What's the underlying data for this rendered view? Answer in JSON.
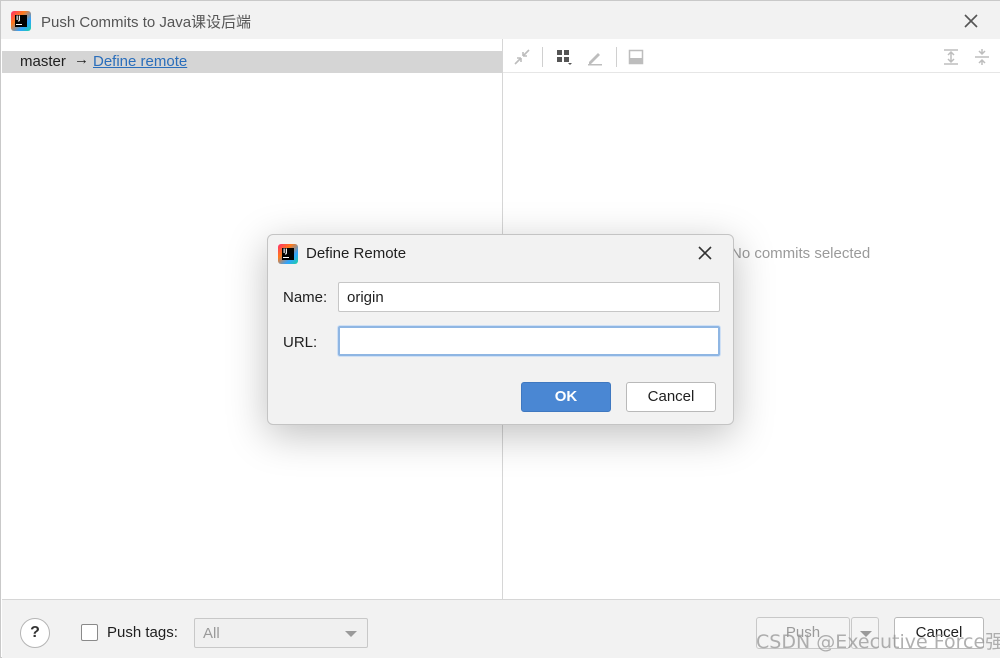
{
  "window": {
    "title": "Push Commits to Java课设后端"
  },
  "left": {
    "branch": "master",
    "arrow": "→",
    "define_remote_link": "Define remote"
  },
  "right": {
    "empty_text": "No commits selected"
  },
  "bottom": {
    "help_label": "?",
    "push_tags_label": "Push tags:",
    "push_tags_checked": false,
    "tags_select_value": "All",
    "push_label": "Push",
    "cancel_label": "Cancel"
  },
  "modal": {
    "title": "Define Remote",
    "name_label": "Name:",
    "name_value": "origin",
    "url_label": "URL:",
    "url_value": "",
    "ok_label": "OK",
    "cancel_label": "Cancel"
  },
  "watermark": "CSDN @Executive Force强",
  "colors": {
    "accent": "#4a87d3",
    "link": "#2a6ebb",
    "selection": "#d5d5d5"
  }
}
